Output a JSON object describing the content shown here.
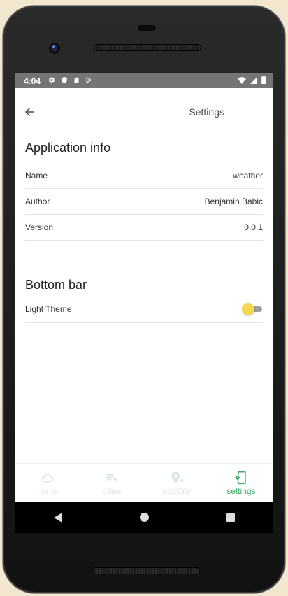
{
  "status_bar": {
    "time": "4:04",
    "icons": [
      "gear-icon",
      "shield-icon",
      "sdcard-icon",
      "play-store-icon"
    ],
    "right_icons": [
      "wifi-icon",
      "signal-icon",
      "battery-icon"
    ]
  },
  "app_bar": {
    "title": "Settings",
    "back_icon": "arrow-left-icon"
  },
  "application_info": {
    "title": "Application info",
    "rows": [
      {
        "label": "Name",
        "value": "weather"
      },
      {
        "label": "Author",
        "value": "Benjamin Babic"
      },
      {
        "label": "Version",
        "value": "0.0.1"
      }
    ]
  },
  "bottom_bar_section": {
    "title": "Bottom bar",
    "light_theme_label": "Light Theme",
    "light_theme_on": false
  },
  "bottom_nav": {
    "items": [
      {
        "label": "home",
        "icon": "cloud-icon",
        "active": false
      },
      {
        "label": "cities",
        "icon": "playlist-add-icon",
        "active": false
      },
      {
        "label": "addCity",
        "icon": "location-add-icon",
        "active": false
      },
      {
        "label": "settings",
        "icon": "phone-settings-icon",
        "active": true
      }
    ]
  },
  "colors": {
    "accent": "#3dac6b",
    "switch_thumb": "#f2d94e",
    "status_bar": "#757575"
  }
}
